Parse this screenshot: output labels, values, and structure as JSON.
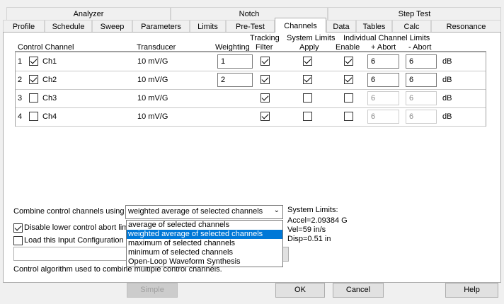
{
  "tabs_top": [
    "Analyzer",
    "Notch",
    "Step Test"
  ],
  "tabs_bottom": [
    "Profile",
    "Schedule",
    "Sweep",
    "Parameters",
    "Limits",
    "Pre-Test",
    "Channels",
    "Data",
    "Tables",
    "Calc",
    "Resonance"
  ],
  "active_tab": "Channels",
  "headers": {
    "control_channel": "Control Channel",
    "transducer": "Transducer",
    "weighting": "Weighting",
    "tracking": "Tracking",
    "filter": "Filter",
    "system_limits": "System Limits",
    "apply": "Apply",
    "individual_limits": "Individual Channel Limits",
    "enable": "Enable",
    "plus_abort": "+ Abort",
    "minus_abort": "- Abort"
  },
  "rows": [
    {
      "num": "1",
      "name": "Ch1",
      "control": true,
      "transducer": "10 mV/G",
      "weighting": "1",
      "tracking": true,
      "apply": true,
      "enable": true,
      "plus_abort": "6",
      "minus_abort": "6",
      "unit": "dB"
    },
    {
      "num": "2",
      "name": "Ch2",
      "control": true,
      "transducer": "10 mV/G",
      "weighting": "2",
      "tracking": true,
      "apply": true,
      "enable": true,
      "plus_abort": "6",
      "minus_abort": "6",
      "unit": "dB"
    },
    {
      "num": "3",
      "name": "Ch3",
      "control": false,
      "transducer": "10 mV/G",
      "weighting": null,
      "tracking": true,
      "apply": false,
      "enable": false,
      "plus_abort": "6",
      "minus_abort": "6",
      "unit": "dB"
    },
    {
      "num": "4",
      "name": "Ch4",
      "control": false,
      "transducer": "10 mV/G",
      "weighting": null,
      "tracking": true,
      "apply": false,
      "enable": false,
      "plus_abort": "6",
      "minus_abort": "6",
      "unit": "dB"
    }
  ],
  "combine": {
    "label": "Combine control channels using",
    "selected": "weighted average of selected channels",
    "options": [
      "average of selected channels",
      "weighted average of selected channels",
      "maximum of selected channels",
      "minimum of selected channels",
      "Open-Loop Waveform Synthesis"
    ],
    "highlighted_index": 1
  },
  "disable_lower_label": "Disable lower control abort lim",
  "load_input_label": "Load this Input Configuration",
  "system_limits": {
    "title": "System Limits:",
    "accel": "Accel=2.09384 G",
    "vel": "Vel=59 in/s",
    "disp": "Disp=0.51 in"
  },
  "status_text": "Control algorithm used to combine multiple control channels.",
  "buttons": {
    "simple": "Simple",
    "ok": "OK",
    "cancel": "Cancel",
    "help": "Help"
  },
  "colors": {
    "highlight": "#0078d7",
    "panel": "#ffffff",
    "dialog": "#f0f0f0"
  }
}
